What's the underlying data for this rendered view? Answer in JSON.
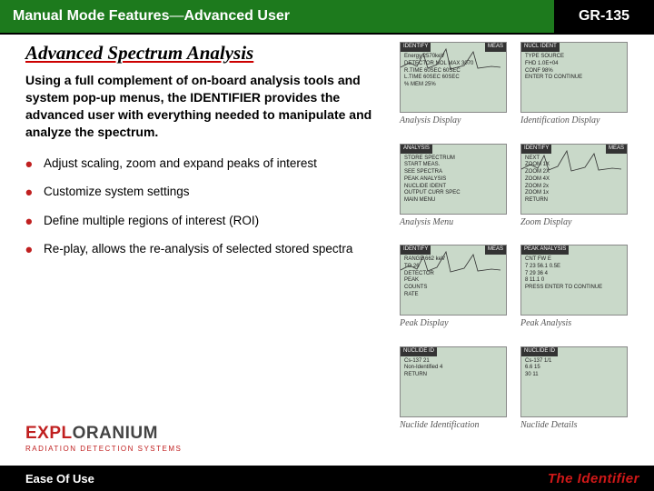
{
  "header": {
    "title_bold": "Manual Mode Features",
    "title_sep": " — ",
    "title_rest": "Advanced User",
    "badge": "GR-135"
  },
  "subtitle": "Advanced Spectrum Analysis",
  "intro": "Using a full complement of on-board analysis tools and system pop-up menus, the IDENTIFIER provides the advanced user with everything needed to manipulate and analyze the spectrum.",
  "bullets": [
    "Adjust scaling, zoom and expand peaks of interest",
    "Customize system settings",
    "Define multiple regions of interest (ROI)",
    "Re-play, allows the re-analysis of selected stored spectra"
  ],
  "thumbs": [
    {
      "caption": "Analysis Display",
      "tab_l": "IDENTIFY",
      "tab_r": "MEAS",
      "lines": [
        "Energy 2570keV",
        "",
        "DETECTOR  NOL MAX  3070",
        "R.TIME  60SEC  60SEC",
        "L.TIME  60SEC  60SEC",
        "% MEM  25%"
      ]
    },
    {
      "caption": "Identification Display",
      "tab_l": "NUCL IDENT",
      "tab_r": "",
      "lines": [
        "TYPE    SOURCE",
        "FHD    1.0E+04",
        "CONF   98%",
        "",
        "ENTER TO CONTINUE"
      ]
    },
    {
      "caption": "Analysis Menu",
      "tab_l": "ANALYSIS",
      "tab_r": "",
      "lines": [
        "STORE SPECTRUM",
        "START MEAS.",
        "SEE SPECTRA",
        "PEAK ANALYSIS",
        "NUCLIDE IDENT",
        "OUTPUT CURR SPEC",
        "MAIN MENU"
      ]
    },
    {
      "caption": "Zoom Display",
      "tab_l": "IDENTIFY",
      "tab_r": "MEAS",
      "lines": [
        "     NEXT",
        "ZOOM 1X",
        "ZOOM 2X",
        "ZOOM 4X",
        "ZOOM 2x",
        "ZOOM 1x",
        "RETURN"
      ]
    },
    {
      "caption": "Peak Display",
      "tab_l": "IDENTIFY",
      "tab_r": "MEAS",
      "lines": [
        "RANGE  662 keV",
        "TO  26",
        "",
        "DETECTOR",
        "PEAK",
        "COUNTS",
        "RATE"
      ]
    },
    {
      "caption": "Peak Analysis",
      "tab_l": "PEAK ANALYSIS",
      "tab_r": "",
      "lines": [
        "CNT  FW  E",
        "7 23  56.1  0.5E",
        "7 29  36  4",
        "8     11.1  0",
        "",
        "PRESS ENTER TO CONTINUE"
      ]
    },
    {
      "caption": "Nuclide Identification",
      "tab_l": "NUCLIDE ID",
      "tab_r": "",
      "lines": [
        "",
        "Cs-137          21",
        "Non-Identified   4",
        "RETURN"
      ]
    },
    {
      "caption": "Nuclide Details",
      "tab_l": "NUCLIDE ID",
      "tab_r": "",
      "lines": [
        "Cs-137    1/1",
        "  6.6    15",
        "  30     11",
        ""
      ]
    }
  ],
  "logo": {
    "brand_a": "EXPL",
    "brand_b": "ORANIUM",
    "sub": "RADIATION DETECTION SYSTEMS"
  },
  "footer": {
    "left": "Ease Of Use",
    "right": "The Identifier"
  }
}
